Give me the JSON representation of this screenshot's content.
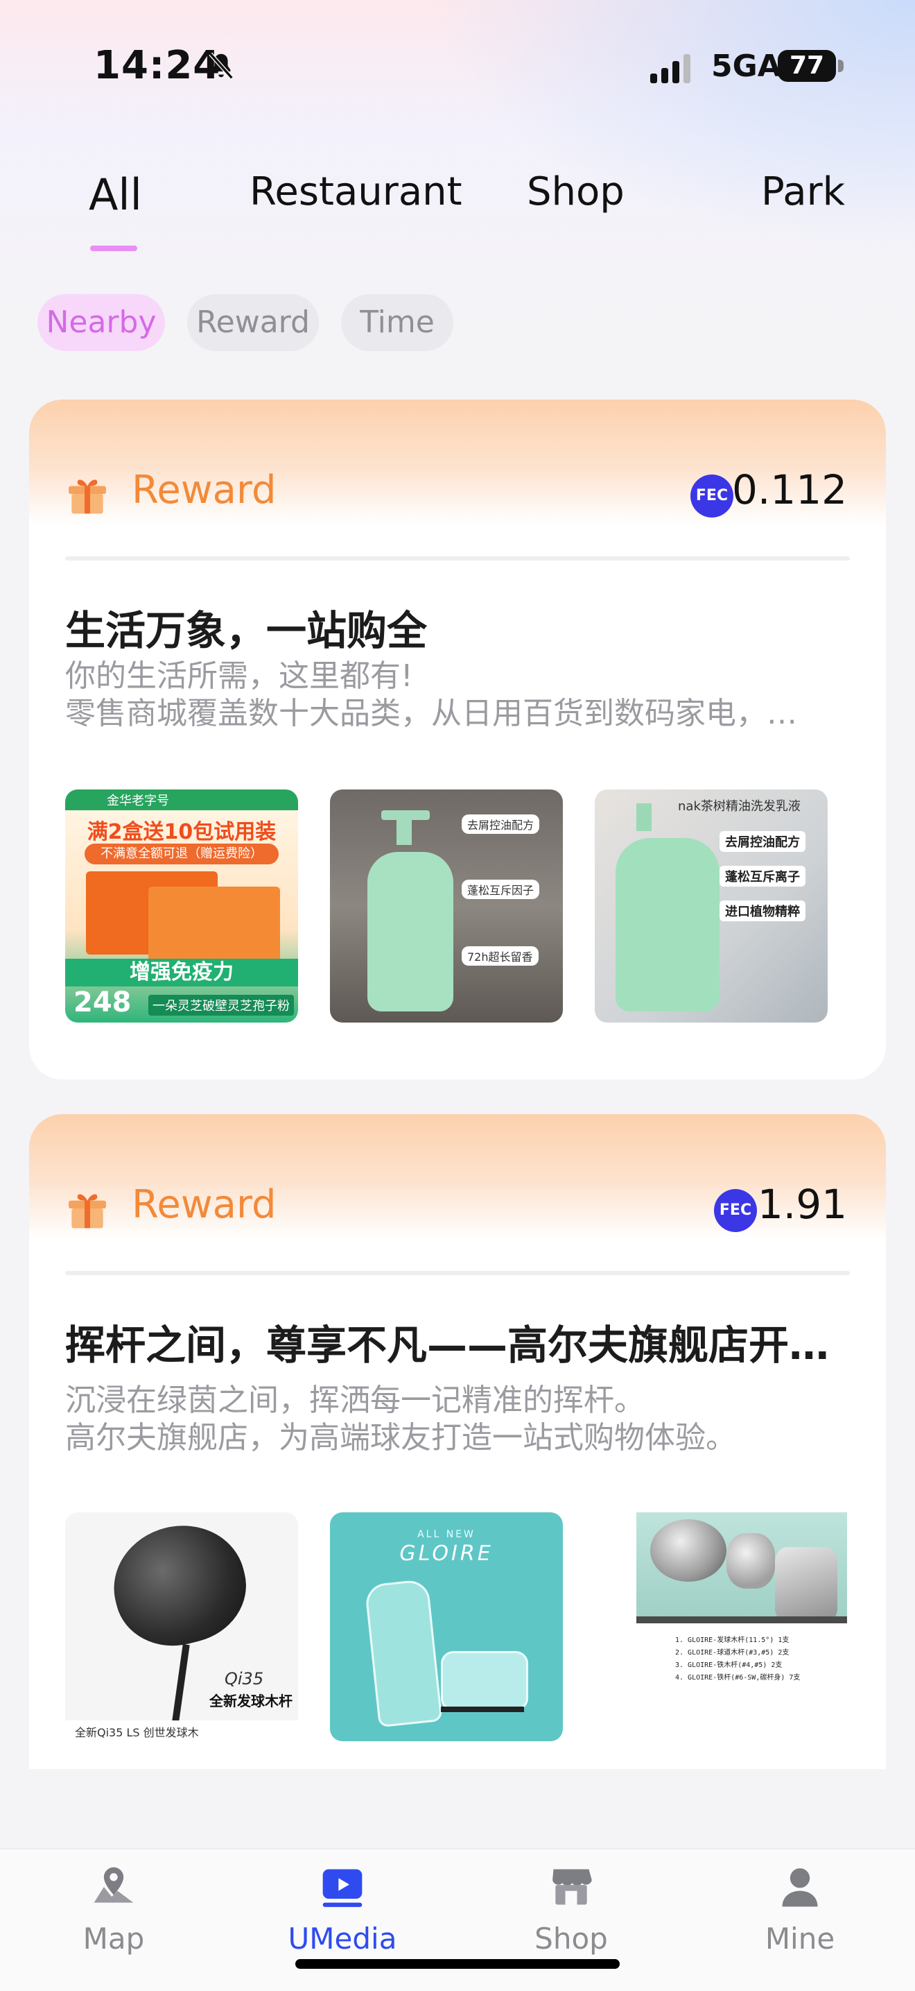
{
  "status_bar": {
    "time": "14:24",
    "network": "5GA",
    "battery": "77"
  },
  "tabs": [
    {
      "label": "All",
      "active": true
    },
    {
      "label": "Restaurant",
      "active": false
    },
    {
      "label": "Shop",
      "active": false
    },
    {
      "label": "Park",
      "active": false
    }
  ],
  "filters": [
    {
      "label": "Nearby",
      "active": true
    },
    {
      "label": "Reward",
      "active": false
    },
    {
      "label": "Time",
      "active": false
    }
  ],
  "cards": [
    {
      "reward_label": "Reward",
      "token": "FEC",
      "amount": "0.112",
      "title": "生活万象，一站购全",
      "desc_line1": "你的生活所需，这里都有!",
      "desc_line2": "零售商城覆盖数十大品类，从日用百货到数码家电，…",
      "images": [
        {
          "name": "reishi-spore-gift-box",
          "badge": "金华老字号",
          "headline": "满2盒送10包试用装",
          "sub": "不满意全额可退（赠运费险）",
          "slogan": "增强免疫力",
          "price": "248",
          "caption": "一朵灵芝破壁灵芝孢子粉"
        },
        {
          "name": "green-shampoo-bottle",
          "tags": [
            "去屑控油配方",
            "蓬松互斥因子",
            "72h超长留香"
          ]
        },
        {
          "name": "green-shampoo-bottle-2",
          "heading": "nak茶树精油洗发乳液",
          "tags": [
            "去屑控油配方",
            "蓬松互斥离子",
            "进口植物精粹"
          ]
        }
      ]
    },
    {
      "reward_label": "Reward",
      "token": "FEC",
      "amount": "1.91",
      "title": "挥杆之间，尊享不凡——高尔夫旗舰店开…",
      "desc_line1": "沉浸在绿茵之间，挥洒每一记精准的挥杆。",
      "desc_line2": "高尔夫旗舰店，为高端球友打造一站式购物体验。",
      "images": [
        {
          "name": "golf-driver",
          "model": "Qi35",
          "caption": "全新发球木杆",
          "footer": "全新Qi35 LS 创世发球木"
        },
        {
          "name": "golf-bag-set",
          "brand_top": "ALL NEW",
          "brand": "GLOIRE"
        },
        {
          "name": "golf-club-set",
          "list": [
            "1. GLOIRE-发球木杆(11.5°)   1支",
            "2. GLOIRE-球道木杆(#3,#5)   2支",
            "3. GLOIRE-铁木杆(#4,#5)   2支",
            "4. GLOIRE-铁杆(#6-SW,碳杆身)   7支"
          ]
        }
      ]
    }
  ],
  "bottom_nav": [
    {
      "label": "Map",
      "icon": "map-pin-icon",
      "active": false
    },
    {
      "label": "UMedia",
      "icon": "play-icon",
      "active": true
    },
    {
      "label": "Shop",
      "icon": "store-icon",
      "active": false
    },
    {
      "label": "Mine",
      "icon": "person-icon",
      "active": false
    }
  ],
  "colors": {
    "accent": "#2f4bf0",
    "reward": "#f28a39",
    "fec": "#3b36e6",
    "chip_active": "#d56ae6",
    "tab_indicator": "#e98ef5"
  }
}
